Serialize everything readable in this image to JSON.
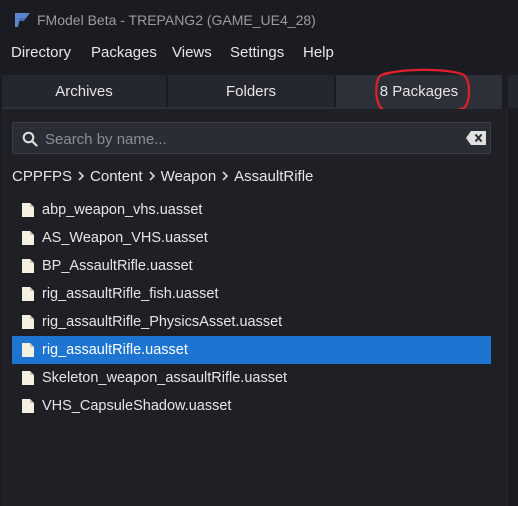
{
  "window": {
    "title": "FModel Beta - TREPANG2 (GAME_UE4_28)"
  },
  "menu": [
    "Directory",
    "Packages",
    "Views",
    "Settings",
    "Help"
  ],
  "tabs": [
    {
      "label": "Archives",
      "active": false
    },
    {
      "label": "Folders",
      "active": false
    },
    {
      "label": "8 Packages",
      "active": true
    }
  ],
  "search": {
    "placeholder": "Search by name...",
    "value": ""
  },
  "breadcrumb": [
    "CPPFPS",
    "Content",
    "Weapon",
    "AssaultRifle"
  ],
  "files": [
    {
      "name": "abp_weapon_vhs.uasset",
      "selected": false
    },
    {
      "name": "AS_Weapon_VHS.uasset",
      "selected": false
    },
    {
      "name": "BP_AssaultRifle.uasset",
      "selected": false
    },
    {
      "name": "rig_assaultRifle_fish.uasset",
      "selected": false
    },
    {
      "name": "rig_assaultRifle_PhysicsAsset.uasset",
      "selected": false
    },
    {
      "name": "rig_assaultRifle.uasset",
      "selected": true
    },
    {
      "name": "Skeleton_weapon_assaultRifle.uasset",
      "selected": false
    },
    {
      "name": "VHS_CapsuleShadow.uasset",
      "selected": false
    }
  ],
  "colors": {
    "accent": "#1e74d1",
    "annotation": "#e0202a",
    "background": "#1b1c21"
  },
  "icons": {
    "app": "fmodel-logo-icon",
    "search": "search-icon",
    "clear": "clear-input-icon",
    "file": "file-icon",
    "separator": "chevron-right-icon"
  }
}
